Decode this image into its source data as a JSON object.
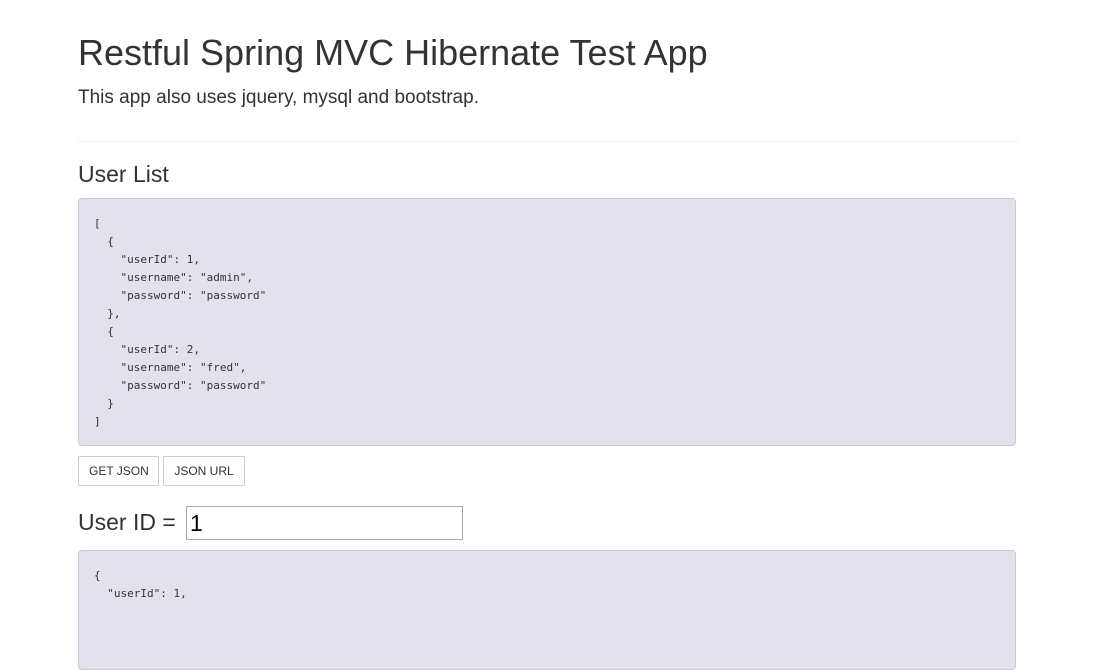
{
  "header": {
    "title": "Restful Spring MVC Hibernate Test App",
    "subtitle": "This app also uses jquery, mysql and bootstrap."
  },
  "user_list": {
    "heading": "User List",
    "json": "[\n  {\n    \"userId\": 1,\n    \"username\": \"admin\",\n    \"password\": \"password\"\n  },\n  {\n    \"userId\": 2,\n    \"username\": \"fred\",\n    \"password\": \"password\"\n  }\n]"
  },
  "actions": {
    "get_json_label": "GET JSON",
    "json_url_label": "JSON URL"
  },
  "user_lookup": {
    "label": "User ID =",
    "value": "1",
    "json": "{\n  \"userId\": 1,"
  },
  "colors": {
    "json_background": "#e3e1eb",
    "json_border": "#c9c7d2",
    "text": "#333333"
  }
}
